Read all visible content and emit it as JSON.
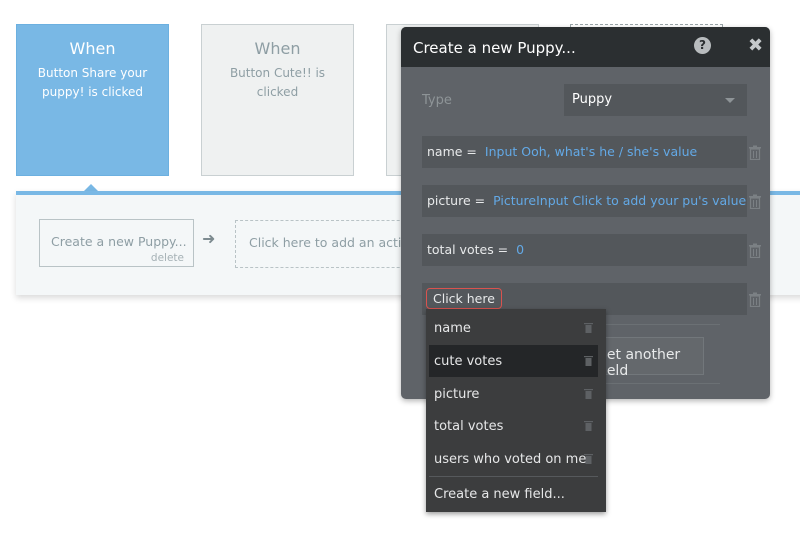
{
  "events": [
    {
      "title": "When",
      "description": "Button Share your puppy! is clicked",
      "selected": true
    },
    {
      "title": "When",
      "description": "Button Cute!! is clicked",
      "selected": false
    }
  ],
  "actions": {
    "step1": {
      "label": "Create a new Puppy...",
      "delete_label": "delete"
    },
    "add_action_label": "Click here to add an action"
  },
  "modal": {
    "title": "Create a new Puppy...",
    "help_icon": "question-circle-icon",
    "close_icon": "close-icon",
    "type_label": "Type",
    "type_value": "Puppy",
    "fields": [
      {
        "key": "name =",
        "value": "Input Ooh, what's he / she's value"
      },
      {
        "key": "picture =",
        "value": "PictureInput Click to add your pu's value"
      },
      {
        "key": "total votes =",
        "value": "0"
      }
    ],
    "new_field_placeholder": "Click here",
    "add_field_button": "Set another field"
  },
  "dropdown": {
    "items": [
      {
        "label": "name",
        "highlighted": false
      },
      {
        "label": "cute votes",
        "highlighted": true
      },
      {
        "label": "picture",
        "highlighted": false
      },
      {
        "label": "total votes",
        "highlighted": false
      },
      {
        "label": "users who voted on me",
        "highlighted": false
      }
    ],
    "create_label": "Create a new field..."
  },
  "colors": {
    "accent": "#79b8e5",
    "link_value": "#63a9e6",
    "modal_bg": "#5f6368",
    "modal_header": "#2b2f31",
    "error_border": "#d9534f"
  }
}
